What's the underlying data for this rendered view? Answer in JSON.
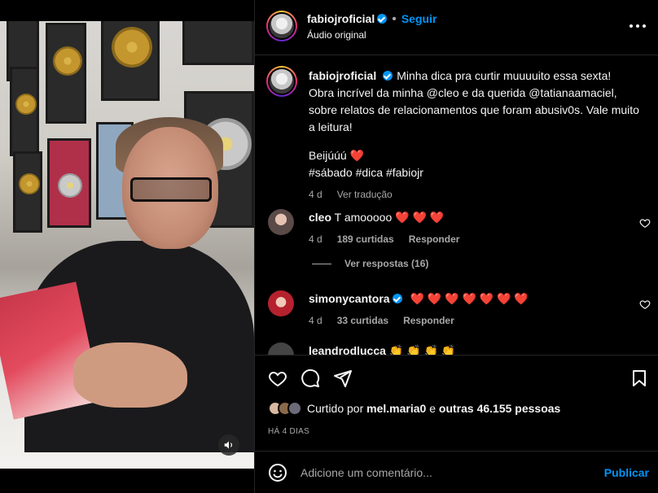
{
  "header": {
    "username": "fabiojroficial",
    "separator": "•",
    "follow_label": "Seguir",
    "audio_label": "Áudio original",
    "more_icon": "more-horizontal-icon"
  },
  "caption": {
    "username": "fabiojroficial",
    "line1": "Minha dica pra curtir muuuuito essa sexta!",
    "line2": "Obra incrível da minha @cleo e da querida @tatianaamaciel,",
    "line3": "sobre relatos de relacionamentos que foram abusiv0s. Vale muito",
    "line4": "a leitura!",
    "signoff": "Beijúúú",
    "signoff_emoji": "❤️",
    "hashtags": "#sábado #dica #fabiojr",
    "age": "4 d",
    "translate_label": "Ver tradução"
  },
  "comments": [
    {
      "username": "cleo",
      "text": "T amooooo",
      "emoji": "❤️ ❤️ ❤️",
      "age": "4 d",
      "likes": "189 curtidas",
      "reply_label": "Responder",
      "avatar_color": "#5a4a48"
    },
    {
      "username": "simonycantora",
      "text": "",
      "emoji": "❤️ ❤️ ❤️ ❤️ ❤️ ❤️ ❤️",
      "age": "4 d",
      "likes": "33 curtidas",
      "reply_label": "Responder",
      "avatar_color": "#b5222e"
    },
    {
      "username": "leandrodlucca",
      "text": "",
      "emoji": "👏 👏 👏 👏",
      "avatar_color": "#444444"
    }
  ],
  "view_replies_label": "Ver respostas (16)",
  "actions": {
    "like_icon": "heart-icon",
    "comment_icon": "comment-icon",
    "share_icon": "send-icon",
    "save_icon": "bookmark-icon"
  },
  "likes": {
    "prefix": "Curtido por",
    "user": "mel.maria0",
    "middle": "e",
    "others": "outras 46.155 pessoas"
  },
  "post_date": "HÁ 4 DIAS",
  "composer": {
    "placeholder": "Adicione um comentário...",
    "publish_label": "Publicar",
    "emoji_icon": "smiley-icon"
  },
  "colors": {
    "accent": "#0095f6",
    "background": "#000000",
    "heart": "#ff3040",
    "muted_text": "#a8a8a8"
  }
}
